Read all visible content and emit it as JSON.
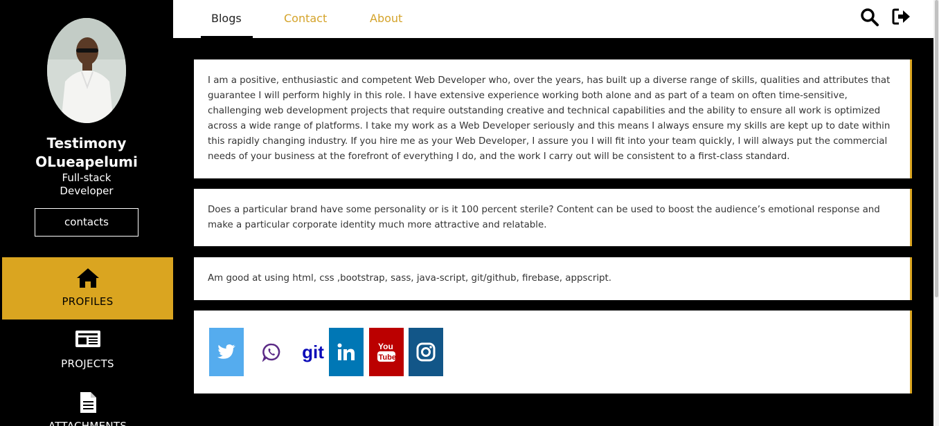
{
  "profile": {
    "name_line1": "Testimony",
    "name_line2": "OLueapelumi",
    "role_line1": "Full-stack",
    "role_line2": "Developer",
    "contacts_label": "contacts"
  },
  "sidebar": {
    "items": [
      {
        "label": "PROFILES",
        "icon": "home-icon",
        "active": true
      },
      {
        "label": "PROJECTS",
        "icon": "newspaper-icon",
        "active": false
      },
      {
        "label": "ATTACHMENTS",
        "icon": "file-text-icon",
        "active": false
      }
    ]
  },
  "header": {
    "tabs": [
      {
        "label": "Blogs",
        "active": true
      },
      {
        "label": "Contact",
        "active": false
      },
      {
        "label": "About",
        "active": false
      }
    ],
    "icons": [
      "search-icon",
      "sign-out-icon"
    ]
  },
  "main": {
    "about_text": "I am a positive, enthusiastic and competent Web Developer who, over the years, has built up a diverse range of skills, qualities and attributes that guarantee I will perform highly in this role. I have extensive experience working both alone and as part of a team on often time-sensitive, challenging web development projects that require outstanding creative and technical capabilities and the ability to ensure all work is optimized across a wide range of platforms. I take my work as a Web Developer seriously and this means I always ensure my skills are kept up to date within this rapidly changing industry. If you hire me as your Web Developer, I assure you I will fit into your team quickly, I will always put the commercial needs of your business at the forefront of everything I do, and the work I carry out will be consistent to a first-class standard.",
    "brand_text": "Does a particular brand have some personality or is it 100 percent sterile? Content can be used to boost the audience’s emotional response and make a particular corporate identity much more attractive and relatable.",
    "skills_text": "Am good at using html, css ,bootstrap, sass, java-script, git/github, firebase, appscript.",
    "social_links": [
      {
        "name": "twitter-icon",
        "color": "#55acee"
      },
      {
        "name": "whatsapp-icon",
        "color": "#5b2a86"
      },
      {
        "name": "git-icon",
        "label": "git",
        "color": "#0a0ab8"
      },
      {
        "name": "linkedin-icon",
        "color": "#0077b5"
      },
      {
        "name": "youtube-icon",
        "color": "#bb0000"
      },
      {
        "name": "instagram-icon",
        "color": "#125688"
      }
    ]
  },
  "colors": {
    "accent": "#daa520",
    "background": "#000000",
    "card": "#ffffff"
  }
}
